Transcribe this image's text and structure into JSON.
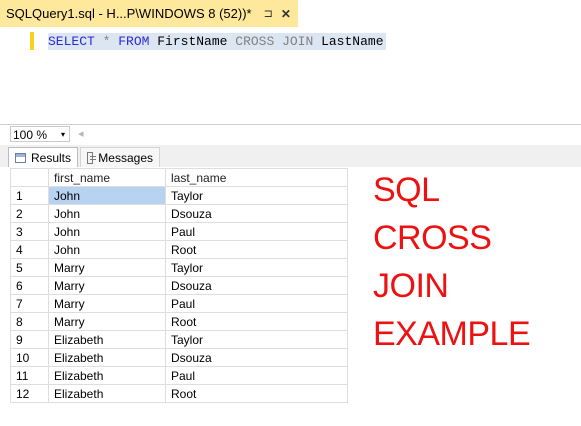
{
  "tab": {
    "title": "SQLQuery1.sql - H...P\\WINDOWS 8 (52))*",
    "pin": "⊐",
    "close": "✕"
  },
  "editor": {
    "query_parts": [
      "SELECT",
      " * ",
      "FROM",
      " FirstName ",
      "CROSS JOIN",
      " LastName"
    ]
  },
  "zoom": {
    "value": "100 %",
    "dropdown": "▾",
    "scroll": "◂"
  },
  "result_tabs": [
    {
      "label": "Results"
    },
    {
      "label": "Messages"
    }
  ],
  "grid": {
    "columns": [
      "first_name",
      "last_name"
    ],
    "rows": [
      [
        "1",
        "John",
        "Taylor"
      ],
      [
        "2",
        "John",
        "Dsouza"
      ],
      [
        "3",
        "John",
        "Paul"
      ],
      [
        "4",
        "John",
        "Root"
      ],
      [
        "5",
        "Marry",
        "Taylor"
      ],
      [
        "6",
        "Marry",
        "Dsouza"
      ],
      [
        "7",
        "Marry",
        "Paul"
      ],
      [
        "8",
        "Marry",
        "Root"
      ],
      [
        "9",
        "Elizabeth",
        "Taylor"
      ],
      [
        "10",
        "Elizabeth",
        "Dsouza"
      ],
      [
        "11",
        "Elizabeth",
        "Paul"
      ],
      [
        "12",
        "Elizabeth",
        "Root"
      ]
    ]
  },
  "overlay": {
    "lines": [
      "SQL",
      "CROSS",
      "JOIN",
      "EXAMPLE"
    ],
    "color": "#ee1111"
  }
}
